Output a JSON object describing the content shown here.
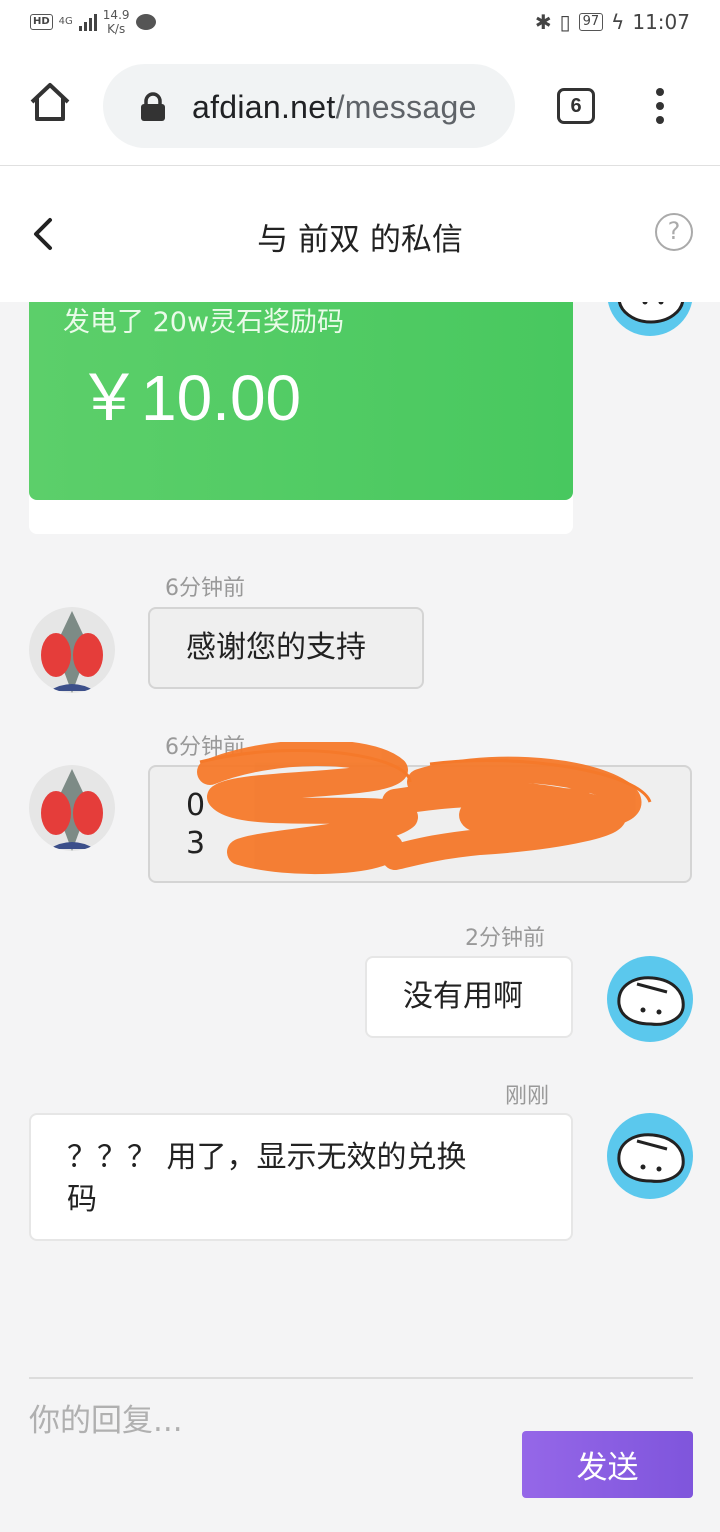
{
  "status_bar": {
    "hd": "HD",
    "network": "4G",
    "speed_value": "14.9",
    "speed_unit": "K/s",
    "battery": "97",
    "time": "11:07"
  },
  "browser": {
    "url_domain": "afdian.net",
    "url_path": "/message",
    "tab_count": "6"
  },
  "header": {
    "title": "与 前双 的私信",
    "help_glyph": "?"
  },
  "card": {
    "title": "发电了 20w灵石奖励码",
    "amount": "￥10.00"
  },
  "messages": [
    {
      "time": "6分钟前",
      "text": "感谢您的支持"
    },
    {
      "time": "6分钟前",
      "line1": "0",
      "line2": "3"
    },
    {
      "time": "2分钟前",
      "text": "没有用啊"
    },
    {
      "time": "刚刚",
      "line1": "？？？ 用了，显示无效的兑换",
      "line2": "码"
    }
  ],
  "reply": {
    "placeholder": "你的回复...",
    "send_label": "发送"
  },
  "colors": {
    "accent_purple": "#8a5fe3",
    "card_green": "#4fcb63",
    "scribble_orange": "#f5792a",
    "avatar_blue": "#5bc8ed"
  }
}
